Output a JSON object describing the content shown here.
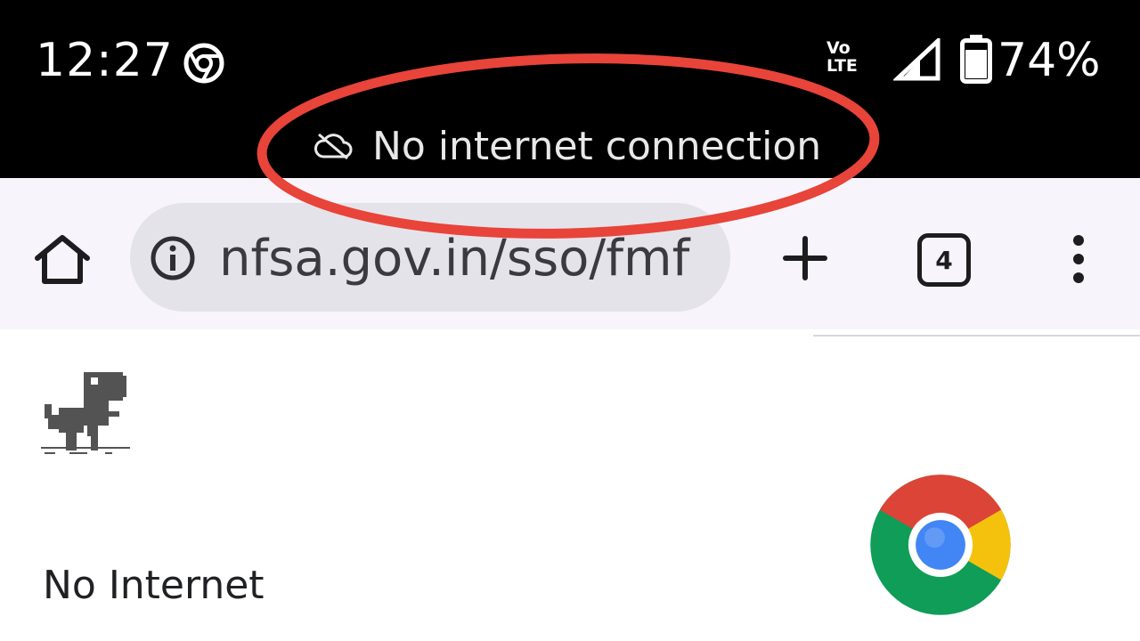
{
  "status_bar": {
    "time": "12:27",
    "network_label_top": "Vo",
    "network_label_bottom": "LTE",
    "battery": "74%",
    "notice": "No internet connection"
  },
  "toolbar": {
    "url": "nfsa.gov.in/sso/fmf",
    "tab_count": "4"
  },
  "page": {
    "heading": "No Internet"
  },
  "colors": {
    "annotation": "#e8443a",
    "chrome_red": "#db4437",
    "chrome_yellow": "#f4c20d",
    "chrome_green": "#0f9d58",
    "chrome_blue": "#4285f4"
  }
}
